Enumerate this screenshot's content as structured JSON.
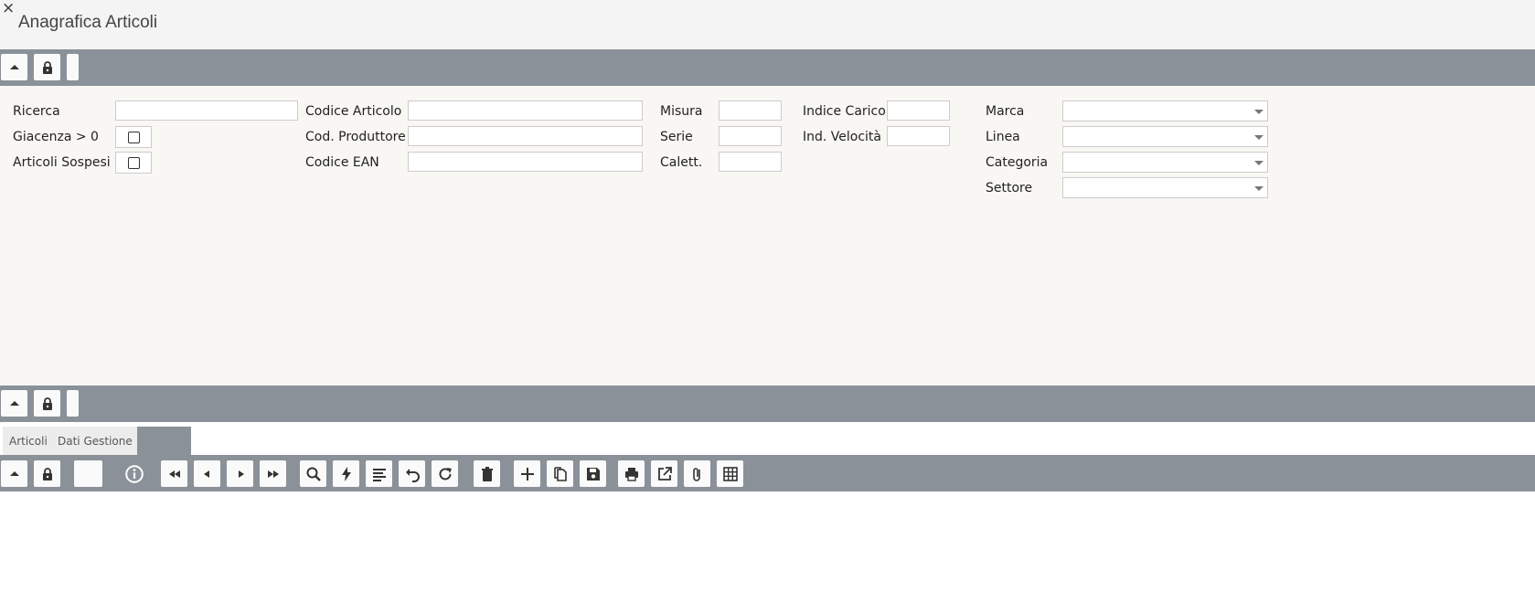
{
  "window": {
    "title": "Anagrafica Articoli",
    "close_glyph": "×"
  },
  "filters": {
    "ricerca_label": "Ricerca",
    "giacenza_label": "Giacenza > 0",
    "sospesi_label": "Articoli Sospesi",
    "codice_articolo_label": "Codice Articolo",
    "cod_produttore_label": "Cod. Produttore",
    "codice_ean_label": "Codice EAN",
    "misura_label": "Misura",
    "serie_label": "Serie",
    "calett_label": "Calett.",
    "indice_carico_label": "Indice Carico",
    "ind_velocita_label": "Ind. Velocità",
    "marca_label": "Marca",
    "linea_label": "Linea",
    "categoria_label": "Categoria",
    "settore_label": "Settore",
    "values": {
      "ricerca": "",
      "codice_articolo": "",
      "cod_produttore": "",
      "codice_ean": "",
      "misura": "",
      "serie": "",
      "calett": "",
      "indice_carico": "",
      "ind_velocita": "",
      "marca": "",
      "linea": "",
      "categoria": "",
      "settore": ""
    },
    "checkboxes": {
      "giacenza": false,
      "sospesi": false
    }
  },
  "tabs": [
    {
      "label": "Articoli"
    },
    {
      "label": "Dati Gestione"
    },
    {
      "label": ""
    }
  ],
  "toolbar_icons": [
    "collapse-icon",
    "lock-icon",
    "info-icon",
    "first-icon",
    "prev-icon",
    "next-icon",
    "last-icon",
    "search-icon",
    "lightning-icon",
    "list-icon",
    "undo-icon",
    "refresh-icon",
    "delete-icon",
    "add-icon",
    "copy-icon",
    "save-icon",
    "print-icon",
    "export-icon",
    "attach-icon",
    "grid-icon"
  ],
  "colors": {
    "toolbar": "#8a9199",
    "panel": "#f9f7f3",
    "titlebar": "#f4f4f4"
  }
}
